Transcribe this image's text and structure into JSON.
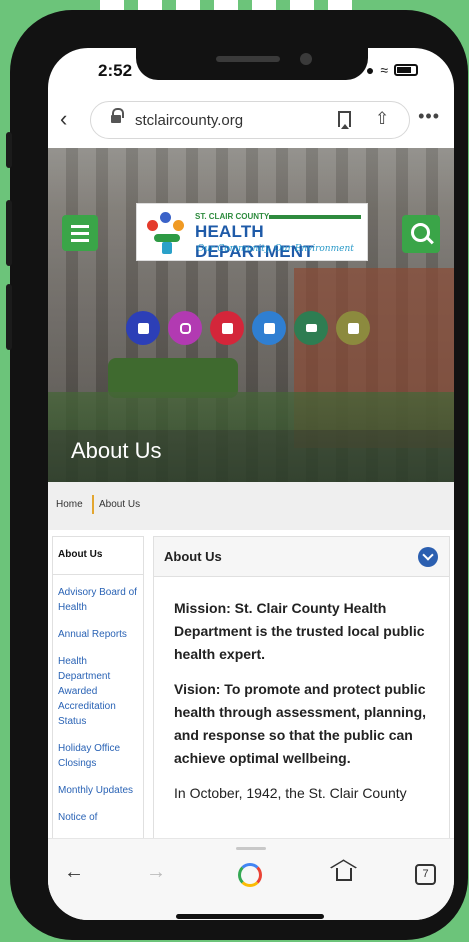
{
  "status_bar": {
    "time": "2:52"
  },
  "browser": {
    "url": "stclaircounty.org",
    "more_label": "•••",
    "back_label": "‹"
  },
  "header": {
    "logo": {
      "line1": "ST. CLAIR COUNTY",
      "line2": "HEALTH DEPARTMENT",
      "tagline": "Our Community, Our Environment"
    },
    "social_icons": [
      {
        "name": "facebook-icon",
        "color": "#2c3fb7"
      },
      {
        "name": "instagram-icon",
        "color": "#b23ab2"
      },
      {
        "name": "youtube-icon",
        "color": "#d4263a"
      },
      {
        "name": "twitter-icon",
        "color": "#2f7fd2"
      },
      {
        "name": "email-icon",
        "color": "#2e7d52"
      },
      {
        "name": "print-icon",
        "color": "#8c8a3e"
      }
    ],
    "page_title": "About Us"
  },
  "breadcrumb": {
    "home": "Home",
    "current": "About Us"
  },
  "sidebar": {
    "title": "About Us",
    "items": [
      "Advisory Board of Health",
      "Annual Reports",
      "Health Department Awarded Accreditation Status",
      "Holiday Office Closings",
      "Monthly Updates",
      "Notice of"
    ]
  },
  "content": {
    "title": "About Us",
    "mission": "Mission: St. Clair County Health Department is the trusted local public health expert.",
    "vision": "Vision: To promote and protect public health through assessment, planning, and response so that the public can achieve optimal wellbeing.",
    "history": "In October, 1942, the St. Clair County"
  },
  "bottom_nav": {
    "back": "←",
    "forward": "→",
    "tabs_count": "7"
  },
  "colors": {
    "background": "#6cc47a",
    "accent_green": "#3aa548",
    "link_blue": "#2a63b5",
    "chevron_blue": "#2b5fb0"
  }
}
